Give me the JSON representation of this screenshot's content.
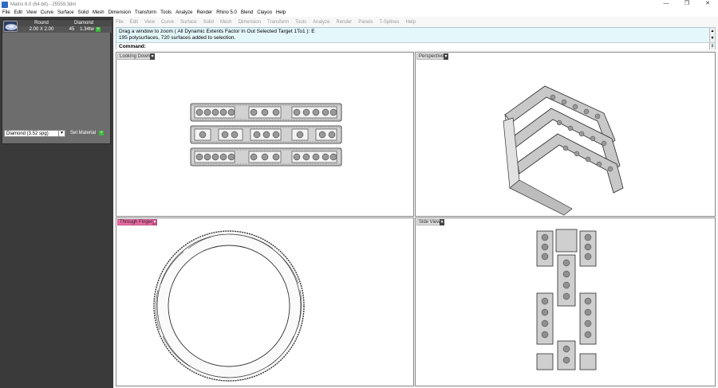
{
  "window": {
    "title": "Matrix 6.0 (64-bit) - 25559.3dm",
    "controls": [
      "—",
      "❐",
      "✕"
    ]
  },
  "menu": [
    "File",
    "Edit",
    "View",
    "Curve",
    "Surface",
    "Solid",
    "Mesh",
    "Dimension",
    "Transform",
    "Tools",
    "Analyze",
    "Render",
    "Rhino 5.0",
    "Blend",
    "Clayoo",
    "Help"
  ],
  "submenu": [
    "File",
    "Edit",
    "View",
    "Curve",
    "Surface",
    "Solid",
    "Mesh",
    "Dimension",
    "Transform",
    "Tools",
    "Analyze",
    "Render",
    "Panels",
    "T-Splines",
    "Help"
  ],
  "gem_table": {
    "headers": [
      "Round",
      "Diamond"
    ],
    "row": {
      "size": "2.00 X 2.00",
      "count": "45",
      "weight": "1.34tw",
      "add": "+"
    }
  },
  "material": {
    "selected": "Diamond     (3.52 spg)",
    "set_label": "Set Material",
    "add": "+"
  },
  "command": {
    "line1": "Drag a window to zoom ( All  Dynamic  Extents  Factor  In  Out  Selected  Target  1To1 ): E",
    "line2": "195 polysurfaces, 720 surfaces added to selection.",
    "prompt": "Command:"
  },
  "viewports": {
    "top_left": "Looking Down",
    "top_right": "Perspective",
    "bottom_left": "Through Finger",
    "bottom_right": "Side View"
  },
  "colors": {
    "accent_active": "#ec6aa5",
    "command_bg": "#e4f7fb",
    "panel_bg": "#3a3a3a",
    "add_green": "#3cb83c"
  }
}
